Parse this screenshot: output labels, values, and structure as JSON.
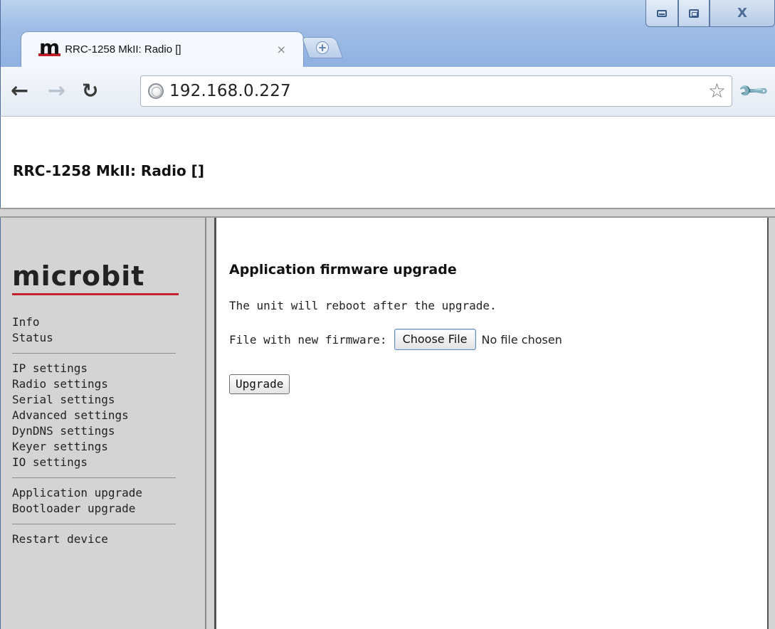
{
  "browser": {
    "tab": {
      "favicon_letter": "m",
      "title": "RRC-1258 MkII: Radio []",
      "close": "×"
    },
    "new_tab": "+",
    "address": "192.168.0.227",
    "window_controls": {
      "minimize": "minimize",
      "maximize": "maximize",
      "close": "X"
    }
  },
  "page": {
    "title": "RRC-1258 MkII: Radio []",
    "logo": "microbit",
    "sidebar": {
      "groups": [
        [
          "Info",
          "Status"
        ],
        [
          "IP settings",
          "Radio settings",
          "Serial settings",
          "Advanced settings",
          "DynDNS settings",
          "Keyer settings",
          "IO settings"
        ],
        [
          "Application upgrade",
          "Bootloader upgrade"
        ],
        [
          "Restart device"
        ]
      ]
    },
    "main": {
      "heading": "Application firmware upgrade",
      "note": "The unit will reboot after the upgrade.",
      "file_label": "File with new firmware:",
      "choose_file": "Choose File",
      "no_file": "No file chosen",
      "upgrade_button": "Upgrade"
    }
  },
  "colors": {
    "accent": "#c4202a",
    "sidebar_bg": "#d4d4d4",
    "title_bar": "#9fbde6"
  }
}
